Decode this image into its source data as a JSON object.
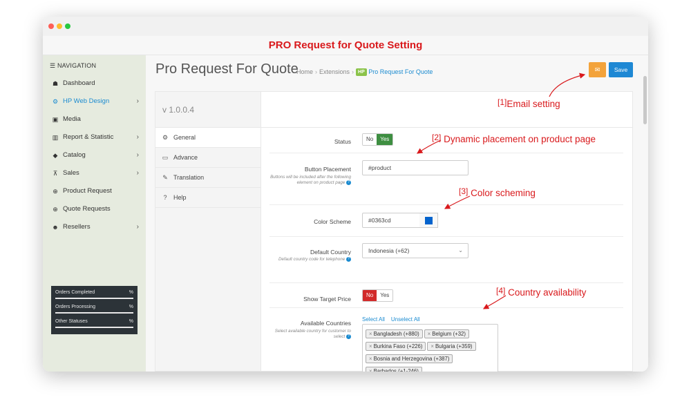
{
  "banner_title": "PRO Request for Quote Setting",
  "sidebar": {
    "header": "NAVIGATION",
    "items": [
      {
        "label": "Dashboard",
        "icon": "dashboard-icon",
        "glyph": "☗",
        "active": false,
        "chevron": ""
      },
      {
        "label": "HP Web Design",
        "icon": "cogs-icon",
        "glyph": "⚙",
        "active": true,
        "chevron": "›"
      },
      {
        "label": "Media",
        "icon": "image-icon",
        "glyph": "▣",
        "active": false,
        "chevron": ""
      },
      {
        "label": "Report & Statistic",
        "icon": "bar-chart-icon",
        "glyph": "▥",
        "active": false,
        "chevron": "›"
      },
      {
        "label": "Catalog",
        "icon": "tag-icon",
        "glyph": "◆",
        "active": false,
        "chevron": "›"
      },
      {
        "label": "Sales",
        "icon": "cart-icon",
        "glyph": "⊼",
        "active": false,
        "chevron": "›"
      },
      {
        "label": "Product Request",
        "icon": "life-ring-icon",
        "glyph": "⊕",
        "active": false,
        "chevron": ""
      },
      {
        "label": "Quote Requests",
        "icon": "life-ring-icon",
        "glyph": "⊕",
        "active": false,
        "chevron": ""
      },
      {
        "label": "Resellers",
        "icon": "users-icon",
        "glyph": "☻",
        "active": false,
        "chevron": "›"
      }
    ],
    "stats": [
      {
        "label": "Orders Completed",
        "pct": "%"
      },
      {
        "label": "Orders Processing",
        "pct": "%"
      },
      {
        "label": "Other Statuses",
        "pct": "%"
      }
    ]
  },
  "header": {
    "page_title": "Pro Request For Quote",
    "breadcrumb": {
      "home": "Home",
      "sep": "›",
      "extensions": "Extensions",
      "badge": "HP",
      "current": "Pro Request For Quote"
    },
    "mail_icon": "envelope-icon",
    "save_label": "Save"
  },
  "tabs": {
    "version": "v 1.0.0.4",
    "items": [
      {
        "label": "General",
        "icon": "gear-icon",
        "glyph": "⚙",
        "active": true
      },
      {
        "label": "Advance",
        "icon": "desktop-icon",
        "glyph": "▭",
        "active": false
      },
      {
        "label": "Translation",
        "icon": "translate-icon",
        "glyph": "✎",
        "active": false
      },
      {
        "label": "Help",
        "icon": "question-icon",
        "glyph": "?",
        "active": false
      }
    ]
  },
  "form": {
    "status": {
      "label": "Status",
      "no": "No",
      "yes": "Yes",
      "value": "Yes"
    },
    "button_placement": {
      "label": "Button Placement",
      "help": "Buttons will be included after the following element on product page",
      "value": "#product"
    },
    "color_scheme": {
      "label": "Color Scheme",
      "value": "#0363cd",
      "swatch_color": "#0363cd"
    },
    "default_country": {
      "label": "Default Country",
      "help": "Default country code for telephone",
      "value": "Indonesia (+62)"
    },
    "show_target_price": {
      "label": "Show Target Price",
      "no": "No",
      "yes": "Yes",
      "value": "No"
    },
    "available_countries": {
      "label": "Available Countries",
      "help": "Select available country for customer to select",
      "select_all": "Select All",
      "unselect_all": "Unselect All",
      "tags": [
        "Bangladesh (+880)",
        "Belgium (+32)",
        "Burkina Faso (+226)",
        "Bulgaria (+359)",
        "Bosnia and Herzegovina (+387)",
        "Barbados (+1-246)"
      ]
    }
  },
  "annotations": [
    {
      "num": "[1]",
      "text": "Email setting"
    },
    {
      "num": "[2]",
      "text": "Dynamic placement on product page"
    },
    {
      "num": "[3]",
      "text": "Color scheming"
    },
    {
      "num": "[4]",
      "text": "Country availability"
    }
  ],
  "colors": {
    "accent_red": "#d9191c",
    "save_blue": "#1e88d4",
    "mail_orange": "#f3a33b",
    "yes_green": "#3e8e41",
    "no_red": "#d22b2b",
    "link_blue": "#1b8bd0"
  }
}
